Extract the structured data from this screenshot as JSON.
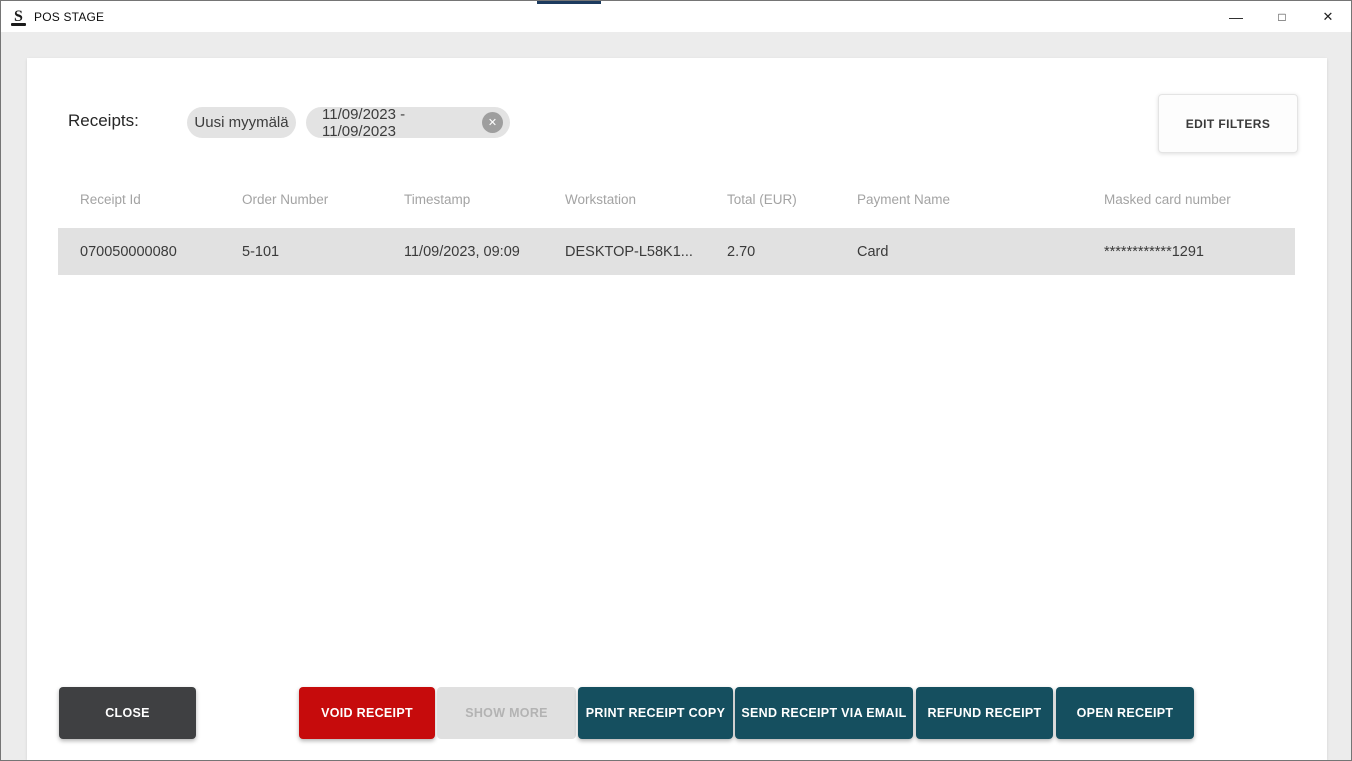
{
  "window": {
    "title": "POS STAGE",
    "controls": {
      "minimize_glyph": "—",
      "maximize_glyph": "□",
      "close_glyph": "✕"
    },
    "logo_glyph": "S"
  },
  "filters": {
    "label": "Receipts:",
    "chips": [
      {
        "label": "Uusi myymälä",
        "closable": false
      },
      {
        "label": "11/09/2023 - 11/09/2023",
        "closable": true,
        "close_glyph": "✕"
      }
    ],
    "edit_button_label": "EDIT FILTERS"
  },
  "table": {
    "columns": [
      "Receipt Id",
      "Order Number",
      "Timestamp",
      "Workstation",
      "Total (EUR)",
      "Payment Name",
      "Masked card number"
    ],
    "rows": [
      {
        "receipt_id": "070050000080",
        "order_number": "5-101",
        "timestamp": "11/09/2023, 09:09",
        "workstation": "DESKTOP-L58K1...",
        "total": "2.70",
        "payment_name": "Card",
        "masked_card": "************1291"
      }
    ]
  },
  "actions": {
    "close": "CLOSE",
    "void_receipt": "VOID RECEIPT",
    "show_more": "SHOW MORE",
    "print_receipt_copy": "PRINT RECEIPT COPY",
    "send_receipt_via_email": "SEND RECEIPT VIA EMAIL",
    "refund_receipt": "REFUND RECEIPT",
    "open_receipt": "OPEN RECEIPT"
  },
  "colors": {
    "teal_button": "#154f5f",
    "red_button": "#c60b0c",
    "dark_button": "#3f4042",
    "disabled_button_bg": "#e0e0e0",
    "disabled_button_text": "#b3b3b3",
    "row_background": "#e1e1e1",
    "chip_background": "#e3e3e3",
    "content_background": "#ececec",
    "top_accent": "#1c3a5e"
  }
}
